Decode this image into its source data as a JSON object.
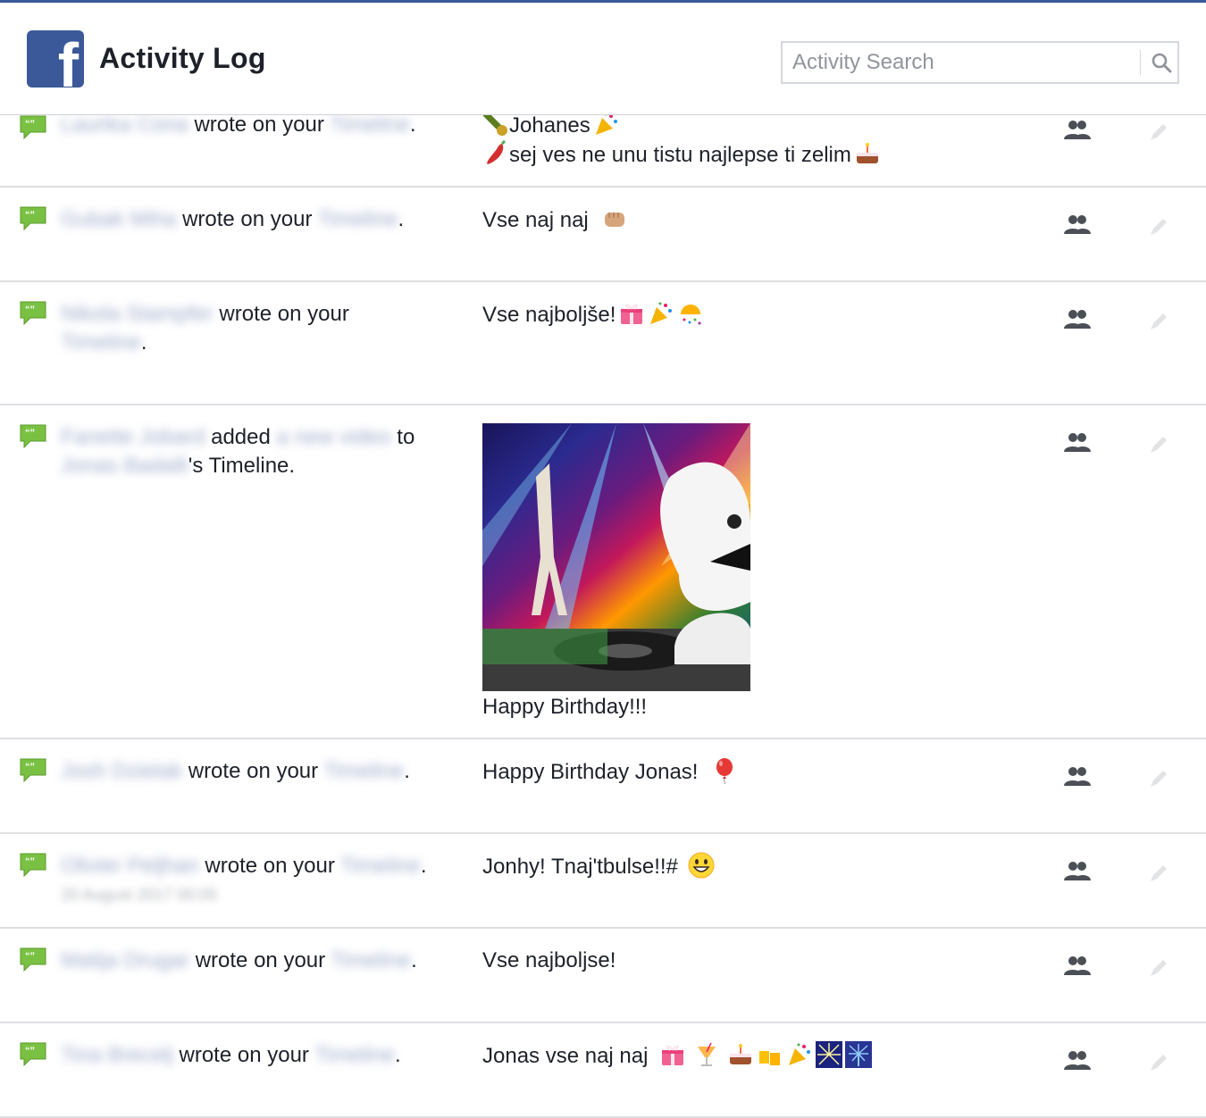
{
  "header": {
    "logo_letter": "f",
    "title": "Activity Log",
    "search": {
      "placeholder": "Activity Search",
      "value": ""
    }
  },
  "rows": [
    {
      "actor": "Laurika Cona",
      "action": "wrote on your",
      "object": "Timeline",
      "suffix": ".",
      "content_line1": "Johanes",
      "content_line2": "sej ves ne unu tistu najlepse ti zelim"
    },
    {
      "actor": "Gubak Miha",
      "action": "wrote on your",
      "object": "Timeline",
      "suffix": ".",
      "content": "Vse naj naj"
    },
    {
      "actor": "Nikola Stampfer",
      "action": "wrote on your",
      "object": "Timeline",
      "suffix": ".",
      "content": "Vse najboljše!"
    },
    {
      "actor": "Fanette Jobard",
      "action": "added",
      "object": "a new video",
      "connector": "to",
      "target": "Jonas Badalli",
      "suffix": "'s Timeline.",
      "caption": "Happy Birthday!!!"
    },
    {
      "actor": "Josh Dzielak",
      "action": "wrote on your",
      "object": "Timeline",
      "suffix": ".",
      "content": "Happy Birthday Jonas!"
    },
    {
      "actor": "Olivier Peljhan",
      "action": "wrote on your",
      "object": "Timeline",
      "suffix": ".",
      "date": "20 August 2017 00:05",
      "content": "Jonhy! Tnaj'tbulse!!#"
    },
    {
      "actor": "Matija Drugar",
      "action": "wrote on your",
      "object": "Timeline",
      "suffix": ".",
      "content": "Vse najboljse!"
    },
    {
      "actor": "Tina Brecelj",
      "action": "wrote on your",
      "object": "Timeline",
      "suffix": ".",
      "content": "Jonas vse naj naj"
    }
  ],
  "icons": {
    "story": "speech-bubble-icon",
    "audience": "friends-icon",
    "edit": "pencil-icon",
    "search": "search-icon"
  },
  "colors": {
    "brand": "#3b5998",
    "story_icon": "#7ac143",
    "link": "#365899",
    "text": "#1d2129"
  }
}
